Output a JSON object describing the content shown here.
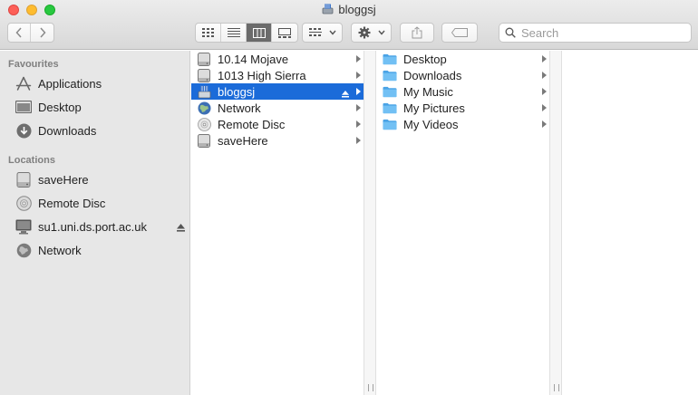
{
  "window": {
    "title": "bloggsj"
  },
  "toolbar": {
    "search_placeholder": "Search",
    "view_modes": [
      "icon-view",
      "list-view",
      "column-view",
      "gallery-view"
    ],
    "active_view": "column-view"
  },
  "sidebar": {
    "favourites_heading": "Favourites",
    "favourites": [
      {
        "label": "Applications",
        "icon": "applications-icon"
      },
      {
        "label": "Desktop",
        "icon": "desktop-icon"
      },
      {
        "label": "Downloads",
        "icon": "downloads-icon"
      }
    ],
    "locations_heading": "Locations",
    "locations": [
      {
        "label": "saveHere",
        "icon": "drive-icon"
      },
      {
        "label": "Remote Disc",
        "icon": "disc-icon"
      },
      {
        "label": "su1.uni.ds.port.ac.uk",
        "icon": "computer-icon",
        "ejectable": true
      },
      {
        "label": "Network",
        "icon": "network-icon"
      }
    ]
  },
  "column1": [
    {
      "label": "10.14 Mojave",
      "icon": "drive-icon"
    },
    {
      "label": "1013 High Sierra",
      "icon": "drive-icon"
    },
    {
      "label": "bloggsj",
      "icon": "network-drive-icon",
      "selected": true,
      "ejectable": true
    },
    {
      "label": "Network",
      "icon": "network-icon"
    },
    {
      "label": "Remote Disc",
      "icon": "disc-icon"
    },
    {
      "label": "saveHere",
      "icon": "drive-icon"
    }
  ],
  "column2": [
    {
      "label": "Desktop",
      "icon": "folder-icon"
    },
    {
      "label": "Downloads",
      "icon": "folder-icon"
    },
    {
      "label": "My Music",
      "icon": "folder-icon"
    },
    {
      "label": "My Pictures",
      "icon": "folder-icon"
    },
    {
      "label": "My Videos",
      "icon": "folder-icon"
    }
  ],
  "colors": {
    "selection": "#1b6bd9",
    "folder": "#5fb6ee",
    "sidebar_bg": "#e7e7e7"
  }
}
